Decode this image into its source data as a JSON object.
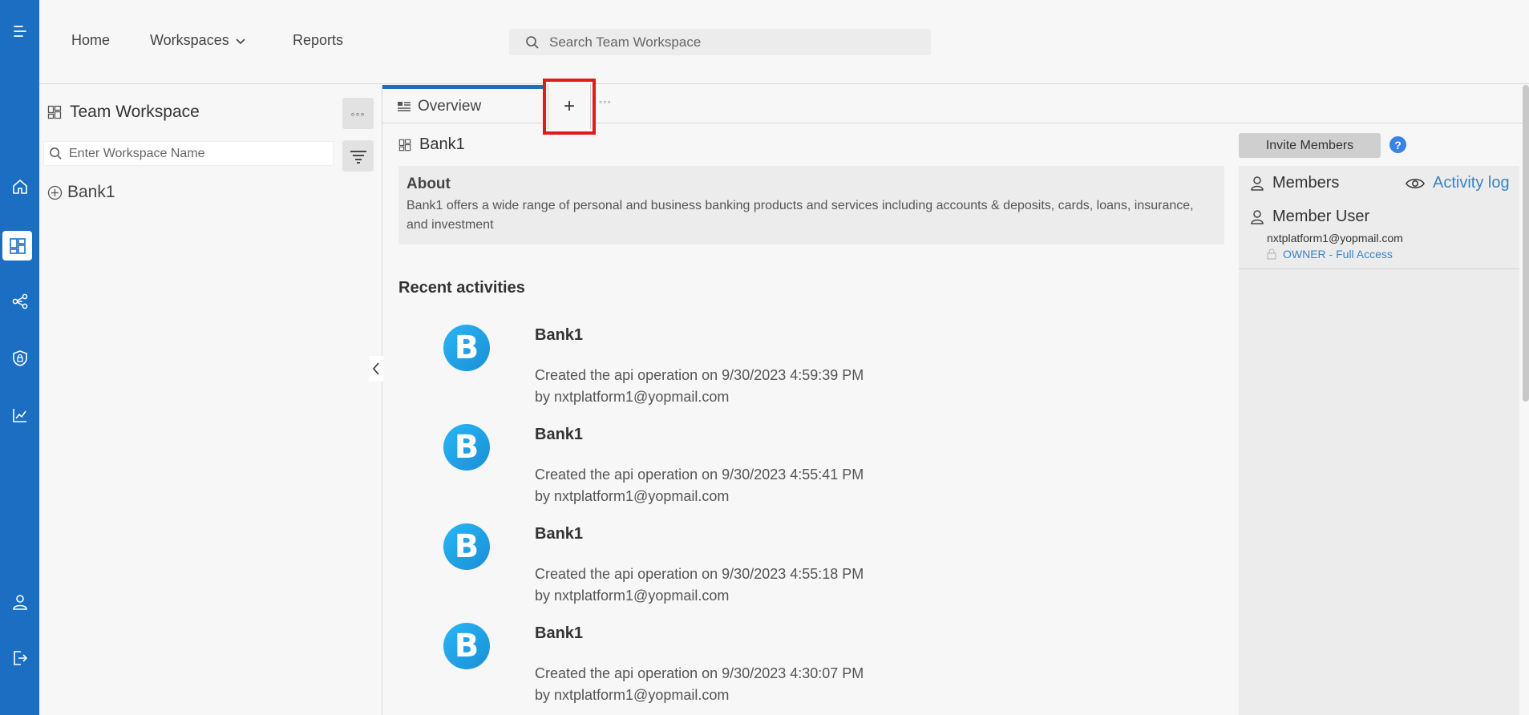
{
  "rail": {
    "icons": [
      "menu-icon",
      "home-icon",
      "workspace-icon",
      "integration-icon",
      "security-icon",
      "analytics-icon",
      "user-icon",
      "logout-icon"
    ]
  },
  "topnav": {
    "home": "Home",
    "workspaces": "Workspaces",
    "reports": "Reports",
    "search_placeholder": "Search Team Workspace"
  },
  "sidebar": {
    "title": "Team Workspace",
    "more_label": "◦◦◦",
    "search_placeholder": "Enter Workspace Name",
    "items": [
      {
        "label": "Bank1"
      }
    ]
  },
  "tabs": {
    "overview": "Overview",
    "add": "+",
    "more": "◦◦◦"
  },
  "main": {
    "workspace_name": "Bank1",
    "about_title": "About",
    "about_text": "Bank1 offers a wide range of personal and business banking products and services including accounts & deposits, cards, loans, insurance, and investment",
    "recent_title": "Recent activities",
    "activities": [
      {
        "avatar": "B",
        "name": "Bank1",
        "line1": "Created the api operation on 9/30/2023 4:59:39 PM",
        "line2": "by nxtplatform1@yopmail.com"
      },
      {
        "avatar": "B",
        "name": "Bank1",
        "line1": "Created the api operation on 9/30/2023 4:55:41 PM",
        "line2": "by nxtplatform1@yopmail.com"
      },
      {
        "avatar": "B",
        "name": "Bank1",
        "line1": "Created the api operation on 9/30/2023 4:55:18 PM",
        "line2": "by nxtplatform1@yopmail.com"
      },
      {
        "avatar": "B",
        "name": "Bank1",
        "line1": "Created the api operation on 9/30/2023 4:30:07 PM",
        "line2": "by nxtplatform1@yopmail.com"
      }
    ]
  },
  "right": {
    "invite": "Invite Members",
    "help": "?",
    "members_title": "Members",
    "activity_log": "Activity log",
    "member": {
      "name": "Member User",
      "email": "nxtplatform1@yopmail.com",
      "role": "OWNER - Full Access"
    }
  },
  "colors": {
    "accent": "#1b6ec2",
    "highlight": "#e01b1b",
    "link": "#3b82c4"
  }
}
